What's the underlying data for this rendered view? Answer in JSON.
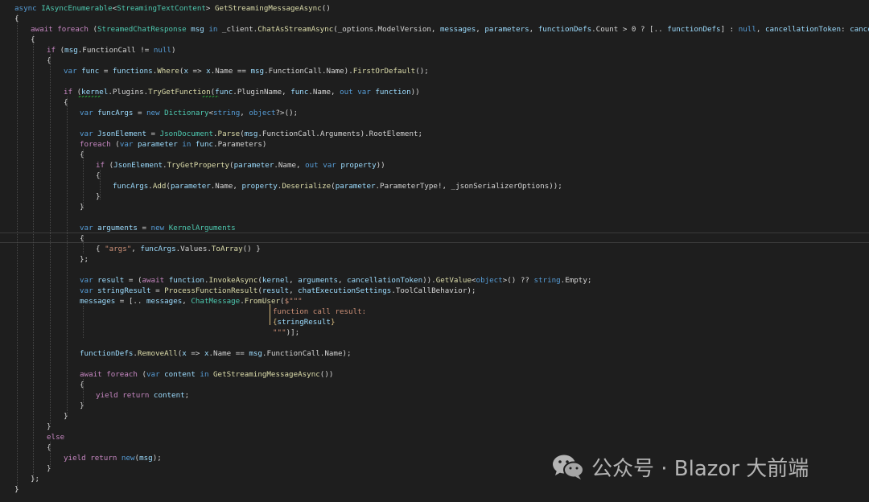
{
  "watermark": {
    "text": "公众号 · Blazor 大前端",
    "icon": "wechat-icon"
  },
  "colors": {
    "background": "#1e1e1e",
    "keyword": "#569cd6",
    "control": "#c586c0",
    "type": "#4ec9b0",
    "method": "#dcdcaa",
    "variable": "#9cdcfe",
    "string": "#ce9178",
    "plain": "#d4d4d4"
  },
  "code": {
    "lines": [
      [
        [
          "kw",
          "async "
        ],
        [
          "ty",
          "IAsyncEnumerable"
        ],
        [
          "pl",
          "<"
        ],
        [
          "ty",
          "StreamingTextContent"
        ],
        [
          "pl",
          "> "
        ],
        [
          "fn",
          "GetStreamingMessageAsync"
        ],
        [
          "pl",
          "()"
        ]
      ],
      [
        [
          "pl",
          "{"
        ]
      ],
      [
        [
          "ctl",
          "await foreach"
        ],
        [
          "pl",
          " ("
        ],
        [
          "ty",
          "StreamedChatResponse"
        ],
        [
          "va",
          " msg"
        ],
        [
          "kw",
          " in"
        ],
        [
          "pl",
          " _client."
        ],
        [
          "fn",
          "ChatAsStreamAsync"
        ],
        [
          "pl",
          "(_options.ModelVersion, "
        ],
        [
          "va",
          "messages"
        ],
        [
          "pl",
          ", "
        ],
        [
          "va",
          "parameters"
        ],
        [
          "pl",
          ", "
        ],
        [
          "va",
          "functionDefs"
        ],
        [
          "pl",
          ".Count > 0 ? [.. "
        ],
        [
          "va",
          "functionDefs"
        ],
        [
          "pl",
          "] : "
        ],
        [
          "kw",
          "null"
        ],
        [
          "pl",
          ", "
        ],
        [
          "va",
          "cancellationToken"
        ],
        [
          "pl",
          ": "
        ],
        [
          "va",
          "cancellationToken"
        ],
        [
          "pl",
          "))"
        ]
      ],
      [
        [
          "pl",
          "{"
        ]
      ],
      [
        [
          "ctl",
          "if"
        ],
        [
          "pl",
          " ("
        ],
        [
          "va",
          "msg"
        ],
        [
          "pl",
          ".FunctionCall != "
        ],
        [
          "kw",
          "null"
        ],
        [
          "pl",
          ")"
        ]
      ],
      [
        [
          "pl",
          "{"
        ]
      ],
      [
        [
          "kw",
          "var"
        ],
        [
          "va",
          " func"
        ],
        [
          "pl",
          " = "
        ],
        [
          "va",
          "functions"
        ],
        [
          "pl",
          "."
        ],
        [
          "fn",
          "Where"
        ],
        [
          "pl",
          "("
        ],
        [
          "va",
          "x"
        ],
        [
          "pl",
          " => "
        ],
        [
          "va",
          "x"
        ],
        [
          "pl",
          ".Name == "
        ],
        [
          "va",
          "msg"
        ],
        [
          "pl",
          ".FunctionCall.Name)."
        ],
        [
          "fn",
          "FirstOrDefault"
        ],
        [
          "pl",
          "();"
        ]
      ],
      [
        [
          "pl",
          ""
        ]
      ],
      [
        [
          "ctl",
          "if"
        ],
        [
          "pl",
          " ("
        ],
        [
          "va",
          "kernel"
        ],
        [
          "pl",
          ".Plugins."
        ],
        [
          "fn",
          "TryGetFunction"
        ],
        [
          "pl",
          "("
        ],
        [
          "va",
          "func"
        ],
        [
          "pl",
          ".PluginName, "
        ],
        [
          "va",
          "func"
        ],
        [
          "pl",
          ".Name, "
        ],
        [
          "kw",
          "out var"
        ],
        [
          "va",
          " function"
        ],
        [
          "pl",
          "))"
        ]
      ],
      [
        [
          "pl",
          "{"
        ]
      ],
      [
        [
          "kw",
          "var"
        ],
        [
          "va",
          " funcArgs"
        ],
        [
          "pl",
          " = "
        ],
        [
          "kw",
          "new"
        ],
        [
          "ty",
          " Dictionary"
        ],
        [
          "pl",
          "<"
        ],
        [
          "kw",
          "string"
        ],
        [
          "pl",
          ", "
        ],
        [
          "kw",
          "object"
        ],
        [
          "pl",
          "?>();"
        ]
      ],
      [
        [
          "pl",
          ""
        ]
      ],
      [
        [
          "kw",
          "var"
        ],
        [
          "va",
          " JsonElement"
        ],
        [
          "pl",
          " = "
        ],
        [
          "ty",
          "JsonDocument"
        ],
        [
          "pl",
          "."
        ],
        [
          "fn",
          "Parse"
        ],
        [
          "pl",
          "("
        ],
        [
          "va",
          "msg"
        ],
        [
          "pl",
          ".FunctionCall.Arguments).RootElement;"
        ]
      ],
      [
        [
          "ctl",
          "foreach"
        ],
        [
          "pl",
          " ("
        ],
        [
          "kw",
          "var"
        ],
        [
          "va",
          " parameter"
        ],
        [
          "kw",
          " in"
        ],
        [
          "va",
          " func"
        ],
        [
          "pl",
          ".Parameters)"
        ]
      ],
      [
        [
          "pl",
          "{"
        ]
      ],
      [
        [
          "ctl",
          "if"
        ],
        [
          "pl",
          " ("
        ],
        [
          "va",
          "JsonElement"
        ],
        [
          "pl",
          "."
        ],
        [
          "fn",
          "TryGetProperty"
        ],
        [
          "pl",
          "("
        ],
        [
          "va",
          "parameter"
        ],
        [
          "pl",
          ".Name, "
        ],
        [
          "kw",
          "out var"
        ],
        [
          "va",
          " property"
        ],
        [
          "pl",
          "))"
        ]
      ],
      [
        [
          "pl",
          "{"
        ]
      ],
      [
        [
          "va",
          "funcArgs"
        ],
        [
          "pl",
          "."
        ],
        [
          "fn",
          "Add"
        ],
        [
          "pl",
          "("
        ],
        [
          "va",
          "parameter"
        ],
        [
          "pl",
          ".Name, "
        ],
        [
          "va",
          "property"
        ],
        [
          "pl",
          "."
        ],
        [
          "fn",
          "Deserialize"
        ],
        [
          "pl",
          "("
        ],
        [
          "va",
          "parameter"
        ],
        [
          "pl",
          ".ParameterType!, _jsonSerializerOptions));"
        ]
      ],
      [
        [
          "pl",
          "}"
        ]
      ],
      [
        [
          "pl",
          "}"
        ]
      ],
      [
        [
          "pl",
          ""
        ]
      ],
      [
        [
          "kw",
          "var"
        ],
        [
          "va",
          " arguments"
        ],
        [
          "pl",
          " = "
        ],
        [
          "kw",
          "new"
        ],
        [
          "ty",
          " KernelArguments"
        ]
      ],
      [
        [
          "pl",
          "{"
        ]
      ],
      [
        [
          "pl",
          "{ "
        ],
        [
          "st",
          "\"args\""
        ],
        [
          "pl",
          ", "
        ],
        [
          "va",
          "funcArgs"
        ],
        [
          "pl",
          ".Values."
        ],
        [
          "fn",
          "ToArray"
        ],
        [
          "pl",
          "() }"
        ]
      ],
      [
        [
          "pl",
          "};"
        ]
      ],
      [
        [
          "pl",
          ""
        ]
      ],
      [
        [
          "kw",
          "var"
        ],
        [
          "va",
          " result"
        ],
        [
          "pl",
          " = ("
        ],
        [
          "ctl",
          "await"
        ],
        [
          "va",
          " function"
        ],
        [
          "pl",
          "."
        ],
        [
          "fn",
          "InvokeAsync"
        ],
        [
          "pl",
          "("
        ],
        [
          "va",
          "kernel"
        ],
        [
          "pl",
          ", "
        ],
        [
          "va",
          "arguments"
        ],
        [
          "pl",
          ", "
        ],
        [
          "va",
          "cancellationToken"
        ],
        [
          "pl",
          "))."
        ],
        [
          "fn",
          "GetValue"
        ],
        [
          "pl",
          "<"
        ],
        [
          "kw",
          "object"
        ],
        [
          "pl",
          ">() ?? "
        ],
        [
          "kw",
          "string"
        ],
        [
          "pl",
          ".Empty;"
        ]
      ],
      [
        [
          "kw",
          "var"
        ],
        [
          "va",
          " stringResult"
        ],
        [
          "pl",
          " = "
        ],
        [
          "fn",
          "ProcessFunctionResult"
        ],
        [
          "pl",
          "("
        ],
        [
          "va",
          "result"
        ],
        [
          "pl",
          ", "
        ],
        [
          "va",
          "chatExecutionSettings"
        ],
        [
          "pl",
          ".ToolCallBehavior);"
        ]
      ],
      [
        [
          "va",
          "messages"
        ],
        [
          "pl",
          " = [.. "
        ],
        [
          "va",
          "messages"
        ],
        [
          "pl",
          ", "
        ],
        [
          "ty",
          "ChatMessage"
        ],
        [
          "pl",
          "."
        ],
        [
          "fn",
          "FromUser"
        ],
        [
          "pl",
          "("
        ],
        [
          "st",
          "$\"\"\""
        ]
      ],
      [
        [
          "st",
          "function call result:"
        ]
      ],
      [
        [
          "sx",
          "{"
        ],
        [
          "va",
          "stringResult"
        ],
        [
          "sx",
          "}"
        ]
      ],
      [
        [
          "st",
          "\"\"\""
        ],
        [
          "pl",
          ")];"
        ]
      ],
      [
        [
          "pl",
          ""
        ]
      ],
      [
        [
          "va",
          "functionDefs"
        ],
        [
          "pl",
          "."
        ],
        [
          "fn",
          "RemoveAll"
        ],
        [
          "pl",
          "("
        ],
        [
          "va",
          "x"
        ],
        [
          "pl",
          " => "
        ],
        [
          "va",
          "x"
        ],
        [
          "pl",
          ".Name == "
        ],
        [
          "va",
          "msg"
        ],
        [
          "pl",
          ".FunctionCall.Name);"
        ]
      ],
      [
        [
          "pl",
          ""
        ]
      ],
      [
        [
          "ctl",
          "await foreach"
        ],
        [
          "pl",
          " ("
        ],
        [
          "kw",
          "var"
        ],
        [
          "va",
          " content"
        ],
        [
          "kw",
          " in"
        ],
        [
          "fn",
          " GetStreamingMessageAsync"
        ],
        [
          "pl",
          "())"
        ]
      ],
      [
        [
          "pl",
          "{"
        ]
      ],
      [
        [
          "ctl",
          "yield return"
        ],
        [
          "va",
          " content"
        ],
        [
          "pl",
          ";"
        ]
      ],
      [
        [
          "pl",
          "}"
        ]
      ],
      [
        [
          "pl",
          "}"
        ]
      ],
      [
        [
          "pl",
          "}"
        ]
      ],
      [
        [
          "ctl",
          "else"
        ]
      ],
      [
        [
          "pl",
          "{"
        ]
      ],
      [
        [
          "ctl",
          "yield return"
        ],
        [
          "kw",
          " new"
        ],
        [
          "pl",
          "("
        ],
        [
          "va",
          "msg"
        ],
        [
          "pl",
          ");"
        ]
      ],
      [
        [
          "pl",
          "}"
        ]
      ],
      [
        [
          "pl",
          "};"
        ]
      ],
      [
        [
          "pl",
          "}"
        ]
      ]
    ]
  }
}
